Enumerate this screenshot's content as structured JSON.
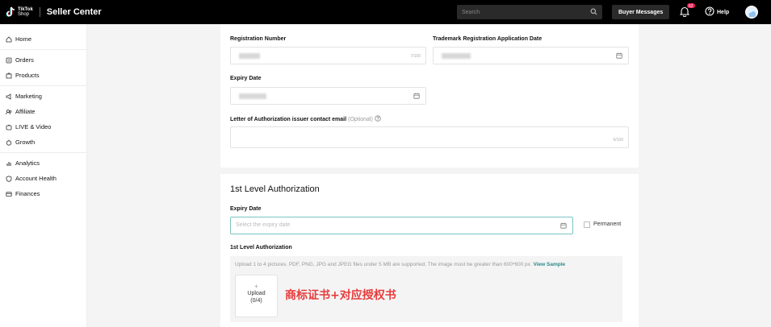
{
  "header": {
    "brand_line1": "TikTok",
    "brand_line2": "Shop",
    "title": "Seller Center",
    "search_placeholder": "Search",
    "buyer_messages": "Buyer Messages",
    "notification_count": "62",
    "help": "Help",
    "colors": {
      "bar": "#000000",
      "badge": "#ee1d52"
    }
  },
  "sidebar": {
    "items": [
      {
        "label": "Home",
        "icon": "home-icon"
      },
      {
        "label": "Orders",
        "icon": "orders-icon"
      },
      {
        "label": "Products",
        "icon": "products-icon"
      },
      {
        "label": "Marketing",
        "icon": "megaphone-icon"
      },
      {
        "label": "Affiliate",
        "icon": "affiliate-icon"
      },
      {
        "label": "LIVE & Video",
        "icon": "video-icon"
      },
      {
        "label": "Growth",
        "icon": "growth-icon"
      },
      {
        "label": "Analytics",
        "icon": "analytics-icon"
      },
      {
        "label": "Account Health",
        "icon": "shield-icon"
      },
      {
        "label": "Finances",
        "icon": "finances-icon"
      }
    ]
  },
  "form1": {
    "registration_number_label": "Registration Number",
    "registration_number_counter": "7/100",
    "trademark_app_date_label": "Trademark Registration Application Date",
    "expiry_date_label": "Expiry Date",
    "loa_email_label": "Letter of Authorization issuer contact email",
    "loa_email_optional": "(Optional)",
    "loa_email_counter": "0/100"
  },
  "form2": {
    "section_title": "1st Level Authorization",
    "expiry_date_label": "Expiry Date",
    "expiry_date_placeholder": "Select the expiry date",
    "permanent_label": "Permanent",
    "auth_label": "1st Level Authorization",
    "upload_hint": "Upload 1 to 4 pictures. PDF, PNG, JPG and JPEG files under 5 MB are supported. The image must be greater than 600*600 px.",
    "view_sample": "View Sample",
    "upload_plus": "+",
    "upload_label": "Upload",
    "upload_count": "(0/4)",
    "annotation": "商标证书+对应授权书",
    "colors": {
      "focus_border": "#7cc4c4",
      "link": "#2b8a8a",
      "annotation": "#e83a3a"
    }
  }
}
